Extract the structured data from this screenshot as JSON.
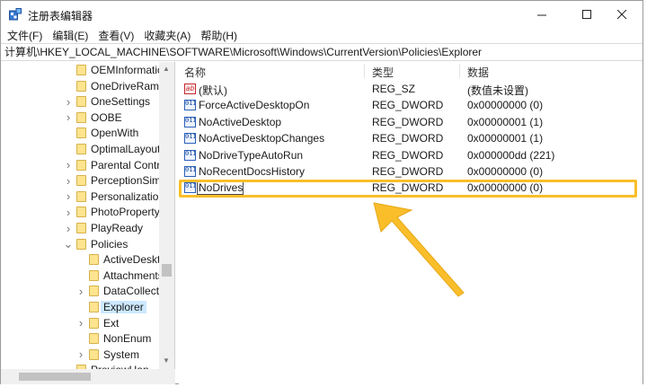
{
  "window": {
    "title": "注册表编辑器",
    "controls": {
      "minimize": "—",
      "maximize": "☐",
      "close": "✕"
    }
  },
  "menu": [
    "文件(F)",
    "编辑(E)",
    "查看(V)",
    "收藏夹(A)",
    "帮助(H)"
  ],
  "address": "计算机\\HKEY_LOCAL_MACHINE\\SOFTWARE\\Microsoft\\Windows\\CurrentVersion\\Policies\\Explorer",
  "tree": [
    {
      "label": "OEMInformatic",
      "level": 1,
      "expander": "",
      "selected": false
    },
    {
      "label": "OneDriveRamp",
      "level": 1,
      "expander": "",
      "selected": false
    },
    {
      "label": "OneSettings",
      "level": 1,
      "expander": ">",
      "selected": false
    },
    {
      "label": "OOBE",
      "level": 1,
      "expander": ">",
      "selected": false
    },
    {
      "label": "OpenWith",
      "level": 1,
      "expander": "",
      "selected": false
    },
    {
      "label": "OptimalLayout",
      "level": 1,
      "expander": "",
      "selected": false
    },
    {
      "label": "Parental Contro",
      "level": 1,
      "expander": ">",
      "selected": false
    },
    {
      "label": "PerceptionSimu",
      "level": 1,
      "expander": ">",
      "selected": false
    },
    {
      "label": "Personalization",
      "level": 1,
      "expander": ">",
      "selected": false
    },
    {
      "label": "PhotoPropertyH",
      "level": 1,
      "expander": ">",
      "selected": false
    },
    {
      "label": "PlayReady",
      "level": 1,
      "expander": ">",
      "selected": false
    },
    {
      "label": "Policies",
      "level": 1,
      "expander": "v",
      "selected": false
    },
    {
      "label": "ActiveDesktc",
      "level": 2,
      "expander": "",
      "selected": false
    },
    {
      "label": "Attachments",
      "level": 2,
      "expander": "",
      "selected": false
    },
    {
      "label": "DataCollecti",
      "level": 2,
      "expander": ">",
      "selected": false
    },
    {
      "label": "Explorer",
      "level": 2,
      "expander": "",
      "selected": true
    },
    {
      "label": "Ext",
      "level": 2,
      "expander": ">",
      "selected": false
    },
    {
      "label": "NonEnum",
      "level": 2,
      "expander": "",
      "selected": false
    },
    {
      "label": "System",
      "level": 2,
      "expander": ">",
      "selected": false
    },
    {
      "label": "PreviewHan...",
      "level": 1,
      "expander": "",
      "selected": false
    }
  ],
  "list": {
    "columns": [
      "名称",
      "类型",
      "数据"
    ],
    "rows": [
      {
        "icon": "string-value-icon",
        "name": "(默认)",
        "type": "REG_SZ",
        "data": "(数值未设置)"
      },
      {
        "icon": "binary-value-icon",
        "name": "ForceActiveDesktopOn",
        "type": "REG_DWORD",
        "data": "0x00000000 (0)"
      },
      {
        "icon": "binary-value-icon",
        "name": "NoActiveDesktop",
        "type": "REG_DWORD",
        "data": "0x00000001 (1)"
      },
      {
        "icon": "binary-value-icon",
        "name": "NoActiveDesktopChanges",
        "type": "REG_DWORD",
        "data": "0x00000001 (1)"
      },
      {
        "icon": "binary-value-icon",
        "name": "NoDriveTypeAutoRun",
        "type": "REG_DWORD",
        "data": "0x000000dd (221)"
      },
      {
        "icon": "binary-value-icon",
        "name": "NoRecentDocsHistory",
        "type": "REG_DWORD",
        "data": "0x00000000 (0)"
      },
      {
        "icon": "binary-value-icon",
        "name": "NoDrives",
        "type": "REG_DWORD",
        "data": "0x00000000 (0)",
        "editing": true
      }
    ]
  },
  "colors": {
    "highlight": "#f9be2a",
    "arrow": "#f9be2a",
    "selection": "#cce8ff",
    "folder": "#ffe48f"
  }
}
